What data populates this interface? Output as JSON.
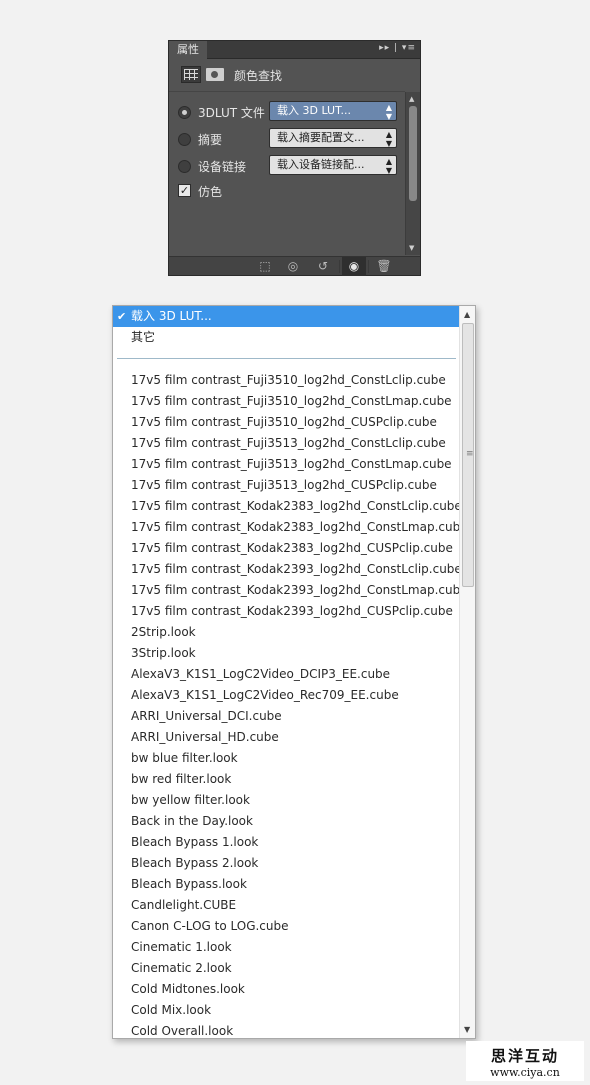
{
  "panel": {
    "tab_label": "属性",
    "tabbar_icons": "▸▸ | ▾≡",
    "title": "颜色查找",
    "rows": [
      {
        "label": "3DLUT 文件",
        "value": "载入 3D LUT...",
        "selected": true
      },
      {
        "label": "摘要",
        "value": "载入摘要配置文...",
        "selected": false
      },
      {
        "label": "设备链接",
        "value": "载入设备链接配...",
        "selected": false
      }
    ],
    "dither_label": "仿色",
    "dither_checked": true,
    "footer_icons": [
      "clip-to-layer-icon",
      "view-previous-state-icon",
      "reset-icon",
      "visibility-eye-icon",
      "trash-icon"
    ]
  },
  "dropdown": {
    "selected": "载入 3D LUT...",
    "other": "其它",
    "items": [
      "17v5 film contrast_Fuji3510_log2hd_ConstLclip.cube",
      "17v5 film contrast_Fuji3510_log2hd_ConstLmap.cube",
      "17v5 film contrast_Fuji3510_log2hd_CUSPclip.cube",
      "17v5 film contrast_Fuji3513_log2hd_ConstLclip.cube",
      "17v5 film contrast_Fuji3513_log2hd_ConstLmap.cube",
      "17v5 film contrast_Fuji3513_log2hd_CUSPclip.cube",
      "17v5 film contrast_Kodak2383_log2hd_ConstLclip.cube",
      "17v5 film contrast_Kodak2383_log2hd_ConstLmap.cube",
      "17v5 film contrast_Kodak2383_log2hd_CUSPclip.cube",
      "17v5 film contrast_Kodak2393_log2hd_ConstLclip.cube",
      "17v5 film contrast_Kodak2393_log2hd_ConstLmap.cube",
      "17v5 film contrast_Kodak2393_log2hd_CUSPclip.cube",
      "2Strip.look",
      "3Strip.look",
      "AlexaV3_K1S1_LogC2Video_DCIP3_EE.cube",
      "AlexaV3_K1S1_LogC2Video_Rec709_EE.cube",
      "ARRI_Universal_DCI.cube",
      "ARRI_Universal_HD.cube",
      "bw blue filter.look",
      "bw red filter.look",
      "bw yellow filter.look",
      "Back in the Day.look",
      "Bleach Bypass 1.look",
      "Bleach Bypass 2.look",
      "Bleach Bypass.look",
      "Candlelight.CUBE",
      "Canon C-LOG to LOG.cube",
      "Cinematic 1.look",
      "Cinematic 2.look",
      "Cold Midtones.look",
      "Cold Mix.look",
      "Cold Overall.look"
    ]
  },
  "watermark": {
    "name": "思洋互动",
    "url": "www.ciya.cn"
  },
  "colors": {
    "panel_bg": "#535353",
    "selection_blue": "#3b95ea",
    "active_select": "#6b87ad"
  }
}
